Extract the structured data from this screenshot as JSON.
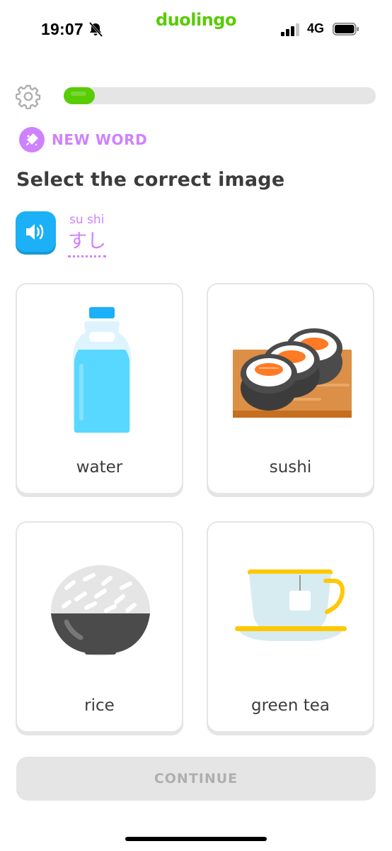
{
  "status_bar": {
    "time": "19:07",
    "brand": "duolingo",
    "network": "4G",
    "icons": [
      "bell-slash-icon",
      "signal-icon",
      "battery-icon"
    ]
  },
  "lesson": {
    "progress_fraction": 0.1,
    "badge_label": "NEW WORD",
    "prompt": "Select the correct image",
    "word_romaji": "su shi",
    "word_kana": "すし"
  },
  "choices": [
    {
      "label": "water",
      "icon": "water-bottle-icon"
    },
    {
      "label": "sushi",
      "icon": "sushi-icon"
    },
    {
      "label": "rice",
      "icon": "rice-bowl-icon"
    },
    {
      "label": "green tea",
      "icon": "tea-cup-icon"
    }
  ],
  "footer": {
    "continue_label": "CONTINUE"
  },
  "colors": {
    "brand_green": "#58cc02",
    "accent_purple": "#ce82ff",
    "audio_blue": "#1cb0f6",
    "disabled_gray": "#e5e5e5"
  }
}
